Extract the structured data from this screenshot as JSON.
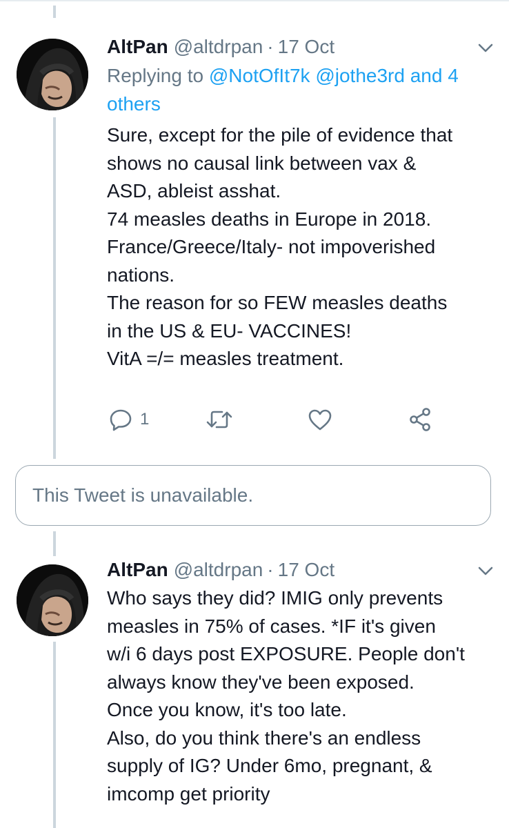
{
  "tweets": [
    {
      "name": "AltPan",
      "handle": "@altdrpan",
      "dot": "·",
      "date": "17 Oct",
      "reply_prefix": "Replying to ",
      "reply_mentions": [
        "@NotOfIt7k",
        "@jothe3rd",
        "and 4 others"
      ],
      "lines": [
        "Sure, except for the pile of evidence that",
        "shows no causal link between vax &",
        "ASD, ableist asshat.",
        "74 measles deaths in Europe in 2018.",
        "France/Greece/Italy- not impoverished",
        "nations.",
        "The reason for so FEW measles deaths",
        "in the US & EU- VACCINES!",
        "VitA =/= measles treatment."
      ],
      "reply_count": "1",
      "icons": {
        "reply": "reply-icon",
        "retweet": "retweet-icon",
        "like": "heart-icon",
        "share": "share-icon",
        "menu": "chevron-down-icon"
      }
    },
    {
      "name": "AltPan",
      "handle": "@altdrpan",
      "dot": "·",
      "date": "17 Oct",
      "lines": [
        "Who says they did? IMIG only prevents",
        "measles in 75% of cases.  *IF it's given",
        "w/i 6 days post EXPOSURE. People don't",
        "always know they've been exposed.",
        "Once you know, it's too late.",
        "Also, do you think there's an endless",
        "supply of IG? Under 6mo, pregnant, &",
        "imcomp get priority"
      ]
    }
  ],
  "unavailable_text": "This Tweet is unavailable.",
  "colors": {
    "link": "#1da1f2",
    "secondary": "#657786",
    "text": "#141823",
    "thread_line": "#ccd6dd"
  }
}
